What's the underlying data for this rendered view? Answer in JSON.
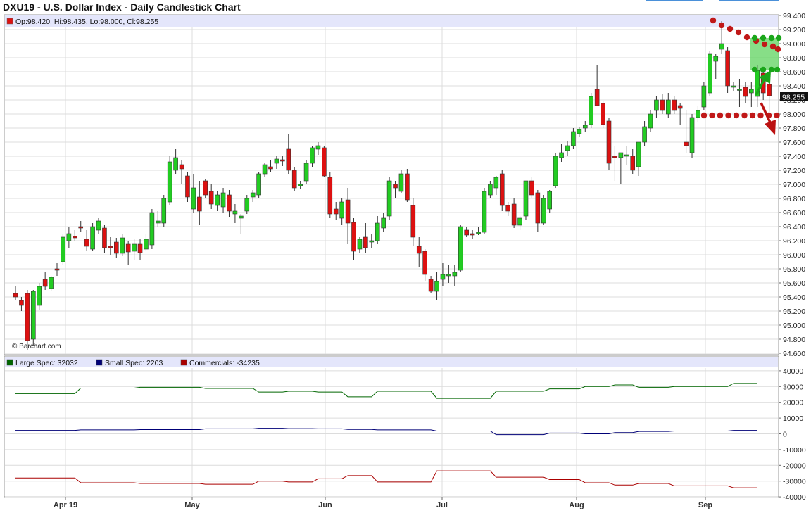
{
  "title": "DXU19 - U.S. Dollar Index - Daily Candlestick Chart",
  "ohlc_label": "Op:98.420, Hi:98.435, Lo:98.000, Cl:98.255",
  "last_price_label": "98.255",
  "watermark": "© Barchart.com",
  "colors": {
    "up": "#22cc22",
    "down": "#dd1111",
    "large": "#006600",
    "small": "#000077",
    "commercials": "#aa0000"
  },
  "chart_data": [
    {
      "type": "candlestick",
      "title": "DXU19 - U.S. Dollar Index - Daily Candlestick Chart",
      "x_ticks": [
        "Apr 19",
        "May",
        "Jun",
        "Jul",
        "Aug",
        "Sep"
      ],
      "y_ticks": [
        "99.400",
        "99.200",
        "99.000",
        "98.800",
        "98.600",
        "98.400",
        "98.200",
        "98.000",
        "97.800",
        "97.600",
        "97.400",
        "97.200",
        "97.000",
        "96.800",
        "96.600",
        "96.400",
        "96.200",
        "96.000",
        "95.800",
        "95.600",
        "95.400",
        "95.200",
        "95.000",
        "94.800",
        "94.600"
      ],
      "ylim": [
        94.6,
        99.4
      ],
      "grid": true,
      "candles": [
        [
          95.45,
          95.55,
          95.35,
          95.4
        ],
        [
          95.35,
          95.4,
          95.2,
          95.28
        ],
        [
          95.45,
          95.5,
          94.65,
          94.78
        ],
        [
          94.8,
          95.5,
          94.7,
          95.48
        ],
        [
          95.28,
          95.6,
          95.22,
          95.55
        ],
        [
          95.65,
          95.75,
          95.5,
          95.55
        ],
        [
          95.52,
          95.7,
          95.48,
          95.68
        ],
        [
          95.8,
          95.88,
          95.7,
          95.78
        ],
        [
          95.9,
          96.3,
          95.85,
          96.25
        ],
        [
          96.2,
          96.4,
          96.1,
          96.3
        ],
        [
          96.26,
          96.35,
          96.2,
          96.24
        ],
        [
          96.4,
          96.48,
          96.33,
          96.38
        ],
        [
          96.22,
          96.35,
          96.05,
          96.12
        ],
        [
          96.08,
          96.45,
          96.05,
          96.4
        ],
        [
          96.35,
          96.52,
          96.3,
          96.48
        ],
        [
          96.38,
          96.42,
          96.02,
          96.1
        ],
        [
          96.12,
          96.25,
          96.0,
          96.1
        ],
        [
          96.18,
          96.24,
          95.96,
          96.02
        ],
        [
          96.02,
          96.3,
          95.98,
          96.24
        ],
        [
          96.15,
          96.2,
          95.85,
          96.04
        ],
        [
          96.05,
          96.22,
          95.92,
          96.15
        ],
        [
          96.15,
          96.22,
          95.92,
          96.03
        ],
        [
          96.08,
          96.3,
          96.05,
          96.22
        ],
        [
          96.14,
          96.65,
          96.08,
          96.6
        ],
        [
          96.45,
          96.62,
          96.4,
          96.48
        ],
        [
          96.45,
          96.85,
          96.4,
          96.8
        ],
        [
          96.75,
          97.4,
          96.7,
          97.32
        ],
        [
          97.2,
          97.5,
          97.15,
          97.38
        ],
        [
          97.28,
          97.35,
          97.0,
          97.22
        ],
        [
          97.12,
          97.18,
          96.75,
          96.82
        ],
        [
          96.65,
          97.15,
          96.6,
          96.95
        ],
        [
          96.82,
          97.05,
          96.42,
          96.62
        ],
        [
          97.05,
          97.08,
          96.8,
          96.85
        ],
        [
          96.9,
          97.0,
          96.65,
          96.72
        ],
        [
          96.7,
          96.9,
          96.62,
          96.85
        ],
        [
          96.68,
          96.95,
          96.6,
          96.88
        ],
        [
          96.85,
          96.92,
          96.53,
          96.62
        ],
        [
          96.58,
          96.72,
          96.45,
          96.62
        ],
        [
          96.52,
          96.58,
          96.3,
          96.55
        ],
        [
          96.62,
          96.85,
          96.58,
          96.8
        ],
        [
          96.82,
          96.92,
          96.75,
          96.88
        ],
        [
          96.85,
          97.18,
          96.8,
          97.15
        ],
        [
          97.15,
          97.3,
          97.1,
          97.28
        ],
        [
          97.25,
          97.34,
          97.18,
          97.22
        ],
        [
          97.3,
          97.4,
          97.22,
          97.36
        ],
        [
          97.35,
          97.4,
          97.26,
          97.33
        ],
        [
          97.5,
          97.72,
          97.15,
          97.2
        ],
        [
          97.2,
          97.25,
          96.9,
          96.95
        ],
        [
          96.98,
          97.05,
          96.93,
          97.0
        ],
        [
          97.05,
          97.35,
          97.0,
          97.3
        ],
        [
          97.3,
          97.55,
          97.25,
          97.52
        ],
        [
          97.5,
          97.6,
          97.42,
          97.55
        ],
        [
          97.52,
          97.55,
          97.1,
          97.12
        ],
        [
          97.1,
          97.18,
          96.52,
          96.58
        ],
        [
          96.65,
          96.75,
          96.5,
          96.58
        ],
        [
          96.52,
          96.8,
          96.42,
          96.75
        ],
        [
          96.78,
          96.95,
          96.15,
          96.45
        ],
        [
          96.46,
          96.52,
          95.92,
          96.05
        ],
        [
          96.08,
          96.25,
          96.02,
          96.22
        ],
        [
          96.25,
          96.45,
          96.03,
          96.1
        ],
        [
          96.18,
          96.3,
          96.1,
          96.2
        ],
        [
          96.2,
          96.55,
          96.15,
          96.45
        ],
        [
          96.38,
          96.6,
          96.33,
          96.52
        ],
        [
          96.55,
          97.1,
          96.5,
          97.05
        ],
        [
          97.0,
          97.05,
          96.8,
          96.95
        ],
        [
          96.9,
          97.2,
          96.88,
          97.15
        ],
        [
          97.15,
          97.22,
          96.75,
          96.78
        ],
        [
          96.7,
          96.8,
          96.12,
          96.25
        ],
        [
          96.12,
          96.25,
          95.83,
          96.02
        ],
        [
          96.05,
          96.08,
          95.62,
          95.72
        ],
        [
          95.65,
          95.7,
          95.45,
          95.48
        ],
        [
          95.48,
          95.75,
          95.35,
          95.62
        ],
        [
          95.65,
          95.88,
          95.55,
          95.72
        ],
        [
          95.7,
          95.85,
          95.6,
          95.72
        ],
        [
          95.7,
          95.85,
          95.55,
          95.75
        ],
        [
          95.78,
          96.42,
          95.75,
          96.4
        ],
        [
          96.35,
          96.4,
          96.25,
          96.28
        ],
        [
          96.3,
          96.35,
          96.23,
          96.28
        ],
        [
          96.3,
          96.4,
          96.28,
          96.32
        ],
        [
          96.32,
          96.95,
          96.3,
          96.9
        ],
        [
          96.85,
          97.05,
          96.8,
          97.0
        ],
        [
          96.95,
          97.12,
          96.85,
          97.1
        ],
        [
          97.15,
          97.2,
          96.62,
          96.7
        ],
        [
          96.7,
          96.75,
          96.55,
          96.62
        ],
        [
          96.72,
          96.8,
          96.38,
          96.42
        ],
        [
          96.42,
          96.55,
          96.35,
          96.52
        ],
        [
          96.55,
          97.05,
          96.5,
          97.05
        ],
        [
          97.05,
          97.1,
          96.8,
          96.85
        ],
        [
          96.88,
          96.92,
          96.32,
          96.45
        ],
        [
          96.45,
          96.85,
          96.42,
          96.8
        ],
        [
          96.65,
          96.92,
          96.6,
          96.9
        ],
        [
          96.98,
          97.45,
          96.95,
          97.4
        ],
        [
          97.38,
          97.58,
          97.32,
          97.45
        ],
        [
          97.48,
          97.62,
          97.4,
          97.55
        ],
        [
          97.55,
          97.8,
          97.5,
          97.75
        ],
        [
          97.72,
          97.82,
          97.68,
          97.78
        ],
        [
          97.8,
          97.9,
          97.75,
          97.84
        ],
        [
          97.85,
          98.3,
          97.8,
          98.25
        ],
        [
          98.35,
          98.7,
          98.12,
          98.12
        ],
        [
          98.15,
          98.18,
          97.8,
          97.85
        ],
        [
          97.9,
          97.95,
          97.2,
          97.3
        ],
        [
          97.4,
          97.55,
          97.05,
          97.38
        ],
        [
          97.38,
          97.45,
          97.0,
          97.45
        ],
        [
          97.4,
          97.55,
          97.28,
          97.42
        ],
        [
          97.4,
          97.5,
          97.15,
          97.2
        ],
        [
          97.25,
          97.55,
          97.12,
          97.6
        ],
        [
          97.6,
          97.9,
          97.55,
          97.82
        ],
        [
          97.8,
          98.05,
          97.75,
          98.0
        ],
        [
          98.05,
          98.25,
          97.95,
          98.2
        ],
        [
          98.2,
          98.28,
          98.0,
          98.05
        ],
        [
          98.0,
          98.3,
          97.95,
          98.2
        ],
        [
          98.2,
          98.25,
          98.0,
          98.05
        ],
        [
          98.12,
          98.15,
          97.85,
          98.08
        ],
        [
          97.6,
          98.05,
          97.45,
          97.55
        ],
        [
          97.45,
          98.0,
          97.38,
          97.95
        ],
        [
          97.95,
          98.12,
          97.88,
          98.05
        ],
        [
          98.1,
          98.45,
          98.05,
          98.4
        ],
        [
          98.3,
          98.9,
          98.25,
          98.85
        ],
        [
          98.75,
          98.85,
          98.5,
          98.82
        ],
        [
          98.92,
          99.32,
          98.85,
          99.0
        ],
        [
          98.9,
          98.95,
          98.3,
          98.4
        ],
        [
          98.38,
          98.45,
          98.32,
          98.4
        ],
        [
          98.35,
          98.5,
          98.1,
          98.35
        ],
        [
          98.38,
          98.45,
          98.15,
          98.25
        ],
        [
          98.3,
          98.45,
          98.1,
          98.35
        ],
        [
          98.25,
          98.7,
          98.1,
          98.62
        ],
        [
          98.58,
          98.65,
          98.2,
          98.3
        ],
        [
          98.42,
          98.44,
          98.0,
          98.26
        ]
      ]
    },
    {
      "type": "line",
      "legend": [
        "Large Spec: 32032",
        "Small Spec: 2203",
        "Commercials: -34235"
      ],
      "y_ticks": [
        "40000",
        "30000",
        "20000",
        "10000",
        "0",
        "-10000",
        "-20000",
        "-30000",
        "-40000"
      ],
      "ylim": [
        -40000,
        40000
      ],
      "x": [
        0,
        10,
        11,
        20,
        21,
        31,
        32,
        40,
        41,
        45,
        46,
        50,
        51,
        55,
        56,
        60,
        61,
        70,
        71,
        80,
        81,
        89,
        90,
        95,
        96,
        100,
        101,
        104,
        105,
        110,
        111,
        120,
        121,
        125
      ],
      "series": [
        {
          "name": "Large Spec",
          "values": [
            25500,
            25500,
            29000,
            29000,
            29500,
            29500,
            28800,
            28800,
            26500,
            26500,
            27000,
            27000,
            26500,
            26500,
            23500,
            23500,
            27000,
            27000,
            22500,
            22500,
            27000,
            27000,
            28500,
            28500,
            30000,
            30000,
            31000,
            31000,
            29500,
            29500,
            30000,
            30000,
            32000,
            32000
          ]
        },
        {
          "name": "Small Spec",
          "values": [
            2200,
            2200,
            2500,
            2500,
            2700,
            2700,
            3200,
            3200,
            3500,
            3500,
            3300,
            3300,
            3200,
            3200,
            2800,
            2800,
            2500,
            2500,
            1800,
            1800,
            -500,
            -500,
            500,
            500,
            0,
            0,
            800,
            800,
            1500,
            1500,
            1800,
            1800,
            2200,
            2200
          ]
        },
        {
          "name": "Commercials",
          "values": [
            -28000,
            -28000,
            -31000,
            -31000,
            -31500,
            -31500,
            -32000,
            -32000,
            -30000,
            -30000,
            -30500,
            -30500,
            -28500,
            -28500,
            -26500,
            -26500,
            -30500,
            -30500,
            -23500,
            -23500,
            -27500,
            -27500,
            -29000,
            -29000,
            -31000,
            -31000,
            -32500,
            -32500,
            -31500,
            -31500,
            -33000,
            -33000,
            -34235,
            -34235
          ]
        }
      ]
    }
  ]
}
